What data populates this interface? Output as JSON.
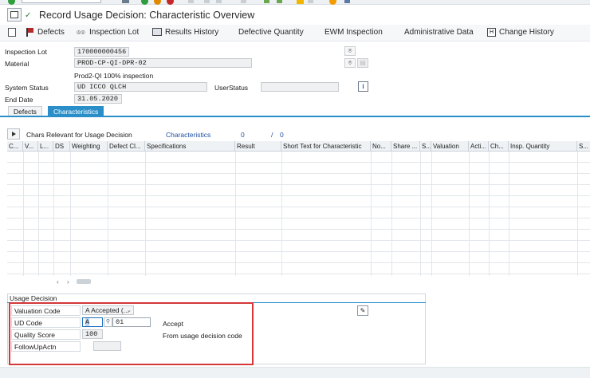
{
  "window": {
    "title": "Record Usage Decision: Characteristic Overview"
  },
  "app_toolbar": {
    "defects": "Defects",
    "inspection_lot": "Inspection Lot",
    "results_history": "Results History",
    "defective_quantity": "Defective Quantity",
    "ewm_inspection": "EWM Inspection",
    "administrative_data": "Administrative Data",
    "change_history": "Change History"
  },
  "header": {
    "inspection_lot_label": "Inspection Lot",
    "inspection_lot_value": "170000000456",
    "material_label": "Material",
    "material_value": "PROD-CP-QI-DPR-02",
    "material_desc": "Prod2-QI 100% inspection",
    "system_status_label": "System Status",
    "system_status_value": "UD   ICCO QLCH",
    "user_status_label": "UserStatus",
    "user_status_value": "",
    "end_date_label": "End Date",
    "end_date_value": "31.05.2020"
  },
  "tabs": [
    {
      "label": "Defects"
    },
    {
      "label": "Characteristics"
    }
  ],
  "chars_bar": {
    "label": "Chars Relevant for Usage Decision",
    "link": "Characteristics",
    "count": "0",
    "separator": "/",
    "total": "0"
  },
  "table": {
    "columns": [
      "C...",
      "V...",
      "L...",
      "DS",
      "Weighting",
      "Defect Cl...",
      "Specifications",
      "Result",
      "Short Text for Characteristic",
      "No...",
      "Share ...",
      "S...",
      "Valuation",
      "Acti...",
      "Ch...",
      "Insp. Quantity",
      "S..."
    ]
  },
  "usage_decision": {
    "section_title": "Usage Decision",
    "valuation_code_label": "Valuation Code",
    "valuation_code_value": "A Accepted (...",
    "ud_code_label": "UD Code",
    "ud_code_value": "A",
    "ud_code_sub": "01",
    "ud_code_text": "Accept",
    "quality_score_label": "Quality Score",
    "quality_score_value": "100",
    "quality_score_text": "From usage decision code",
    "followup_label": "FollowUpActn",
    "followup_value": ""
  },
  "colors": {
    "accent": "#2a8fc8",
    "highlight": "#d4373a"
  }
}
